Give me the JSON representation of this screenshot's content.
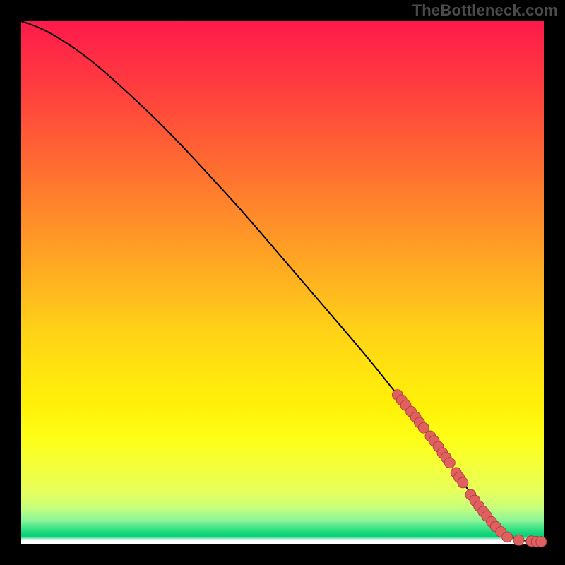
{
  "watermark": "TheBottleneck.com",
  "colors": {
    "dot_fill": "#e06060",
    "dot_stroke": "#a83838",
    "curve": "#000000",
    "frame_bg": "#000000"
  },
  "chart_data": {
    "type": "line",
    "title": "",
    "xlabel": "",
    "ylabel": "",
    "xlim": [
      0,
      100
    ],
    "ylim": [
      0,
      100
    ],
    "grid": false,
    "legend": false,
    "series": [
      {
        "name": "curve",
        "kind": "line",
        "x": [
          0,
          3,
          6,
          10,
          14,
          18,
          24,
          30,
          36,
          42,
          48,
          54,
          60,
          66,
          72,
          78,
          82,
          85,
          88,
          90,
          92,
          94,
          96,
          98,
          100
        ],
        "y": [
          100,
          99,
          97.5,
          95,
          92,
          88.5,
          83,
          77,
          70.5,
          64,
          57,
          50,
          43,
          36,
          28.5,
          21,
          15.5,
          11,
          7,
          4.2,
          2.3,
          1.2,
          0.6,
          0.4,
          0.4
        ]
      },
      {
        "name": "points-upper",
        "kind": "scatter",
        "x": [
          72.0,
          72.8,
          73.6,
          74.6,
          75.5,
          76.2,
          77.0,
          78.3,
          79.0,
          79.8,
          80.6,
          81.3,
          82.0,
          83.2,
          83.8,
          84.5
        ],
        "y": [
          28.5,
          27.5,
          26.5,
          25.3,
          24.2,
          23.2,
          22.2,
          20.6,
          19.7,
          18.6,
          17.4,
          16.5,
          15.5,
          13.6,
          12.7,
          11.7
        ]
      },
      {
        "name": "points-lower",
        "kind": "scatter",
        "x": [
          86.0,
          86.8,
          87.6,
          88.4,
          89.1,
          90.0,
          90.8,
          91.8,
          93.0,
          95.2,
          97.6,
          98.6,
          99.5
        ],
        "y": [
          9.4,
          8.3,
          7.2,
          6.2,
          5.3,
          4.2,
          3.3,
          2.3,
          1.3,
          0.7,
          0.5,
          0.42,
          0.4
        ]
      }
    ]
  }
}
